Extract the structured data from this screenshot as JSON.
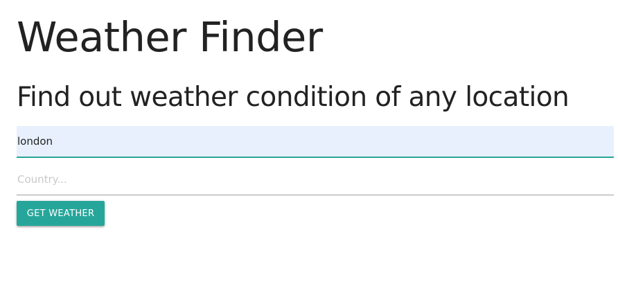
{
  "header": {
    "title": "Weather Finder",
    "subtitle": "Find out weather condition of any location"
  },
  "form": {
    "city": {
      "value": "london",
      "placeholder": ""
    },
    "country": {
      "value": "",
      "placeholder": "Country..."
    },
    "submit_label": "GET WEATHER"
  },
  "colors": {
    "accent": "#26a69a",
    "autofill_background": "#e8f0fe",
    "text": "#222222",
    "placeholder": "#c9c9c9"
  }
}
